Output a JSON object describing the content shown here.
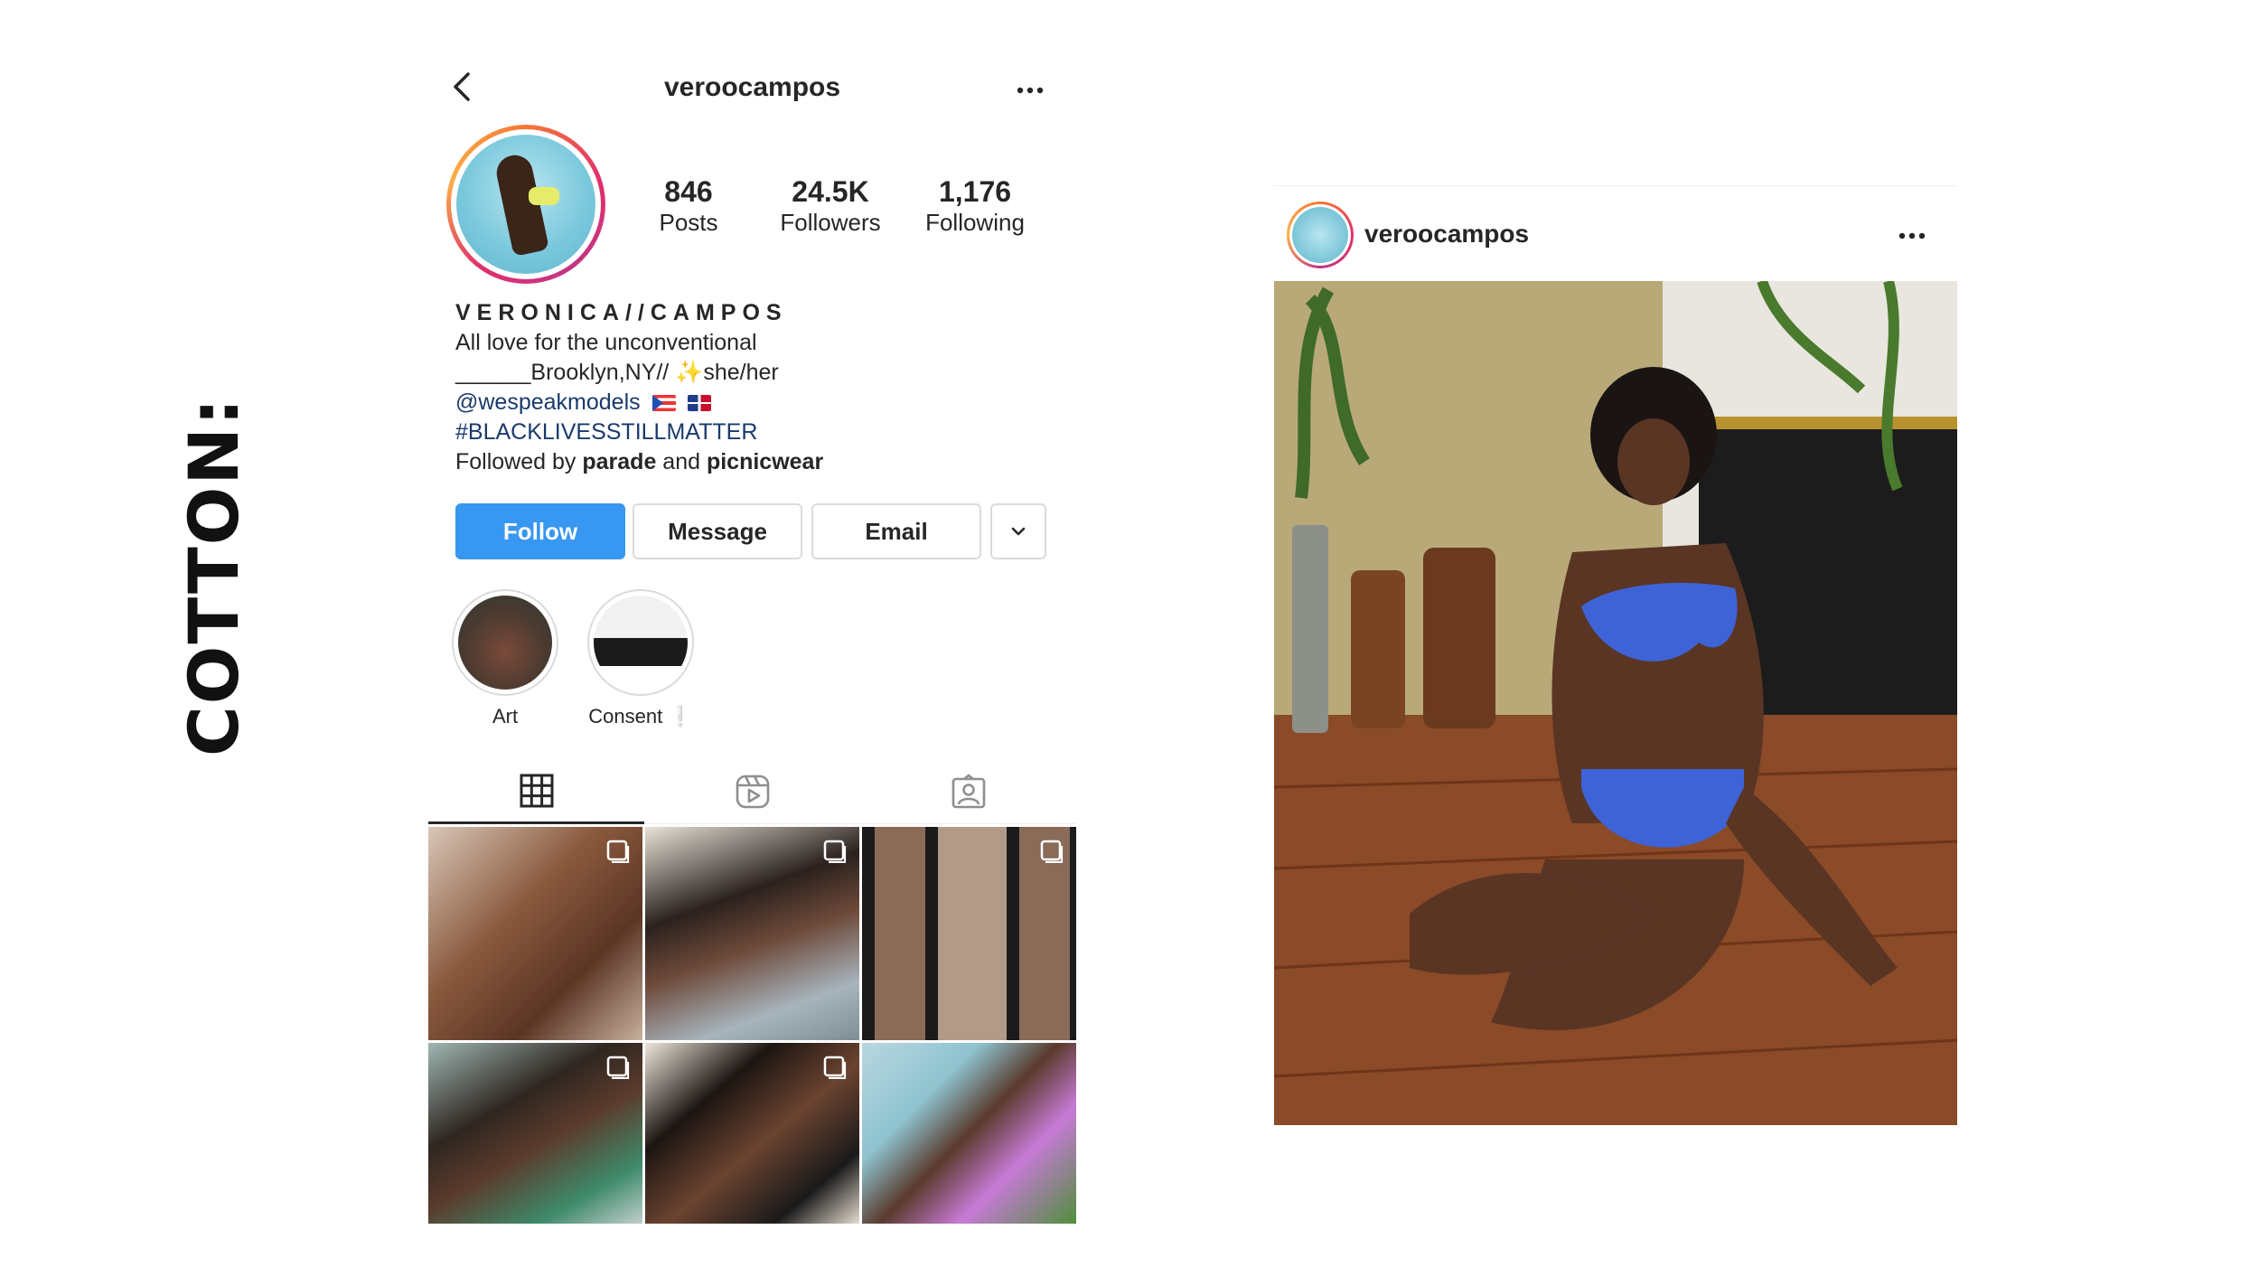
{
  "side_label": "COTTON:",
  "profile": {
    "username": "veroocampos",
    "stats": [
      {
        "value": "846",
        "label": "Posts"
      },
      {
        "value": "24.5K",
        "label": "Followers"
      },
      {
        "value": "1,176",
        "label": "Following"
      }
    ],
    "bio": {
      "name": "VERONICA//CAMPOS",
      "line1": "All love for the unconventional",
      "line2": "______Brooklyn,NY// ✨she/her",
      "mention": "@wespeakmodels",
      "hashtag": "#BLACKLIVESSTILLMATTER",
      "followed_by_prefix": "Followed by",
      "followed_by_1": "parade",
      "followed_by_and": "and",
      "followed_by_2": "picnicwear"
    },
    "buttons": {
      "follow": "Follow",
      "message": "Message",
      "email": "Email"
    },
    "highlights": [
      {
        "label": "Art"
      },
      {
        "label": "Consent ❕"
      }
    ],
    "tabs": [
      "grid-icon",
      "reels-icon",
      "tagged-icon"
    ]
  },
  "post": {
    "username": "veroocampos"
  },
  "colors": {
    "follow_blue": "#3897f0",
    "link_blue": "#1a3a6b",
    "text": "#262626",
    "border": "#dbdbdb"
  }
}
